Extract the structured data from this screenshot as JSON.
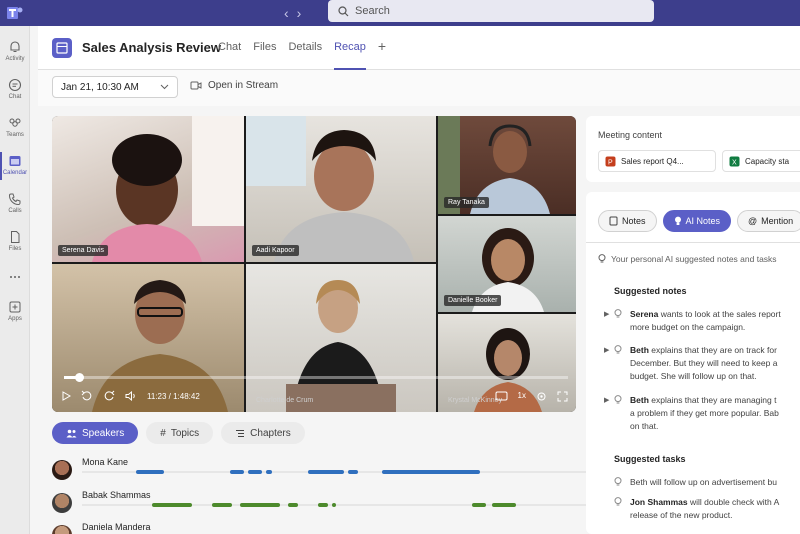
{
  "app": {
    "search_placeholder": "Search"
  },
  "rail": [
    {
      "label": "Activity",
      "icon": "bell-icon"
    },
    {
      "label": "Chat",
      "icon": "chat-icon"
    },
    {
      "label": "Teams",
      "icon": "teams-icon"
    },
    {
      "label": "Calendar",
      "icon": "calendar-icon",
      "active": true
    },
    {
      "label": "Calls",
      "icon": "phone-icon"
    },
    {
      "label": "Files",
      "icon": "file-icon"
    },
    {
      "label": "",
      "icon": "more-icon"
    },
    {
      "label": "Apps",
      "icon": "apps-icon"
    }
  ],
  "header": {
    "title": "Sales Analysis Review",
    "tabs": [
      "Chat",
      "Files",
      "Details",
      "Recap"
    ],
    "active_tab": "Recap"
  },
  "subheader": {
    "date": "Jan 21, 10:30 AM",
    "open_stream": "Open in Stream"
  },
  "video": {
    "participants": [
      "Serena Davis",
      "Aadi Kapoor",
      "Ray Tanaka",
      "Danielle Booker",
      "Charlotte de Crum",
      "Krystal McKinney"
    ],
    "time": "11:23 / 1:48:42",
    "progress": 0.03,
    "speed": "1x"
  },
  "recap_tabs": [
    "Speakers",
    "Topics",
    "Chapters"
  ],
  "speakers": [
    {
      "name": "Mona Kane",
      "color": "#2f6fbe"
    },
    {
      "name": "Babak Shammas",
      "color": "#4d8a2c"
    },
    {
      "name": "Daniela Mandera",
      "color": "#8a5bb0"
    }
  ],
  "right_panel": {
    "meeting_content_title": "Meeting content",
    "files": [
      {
        "name": "Sales report Q4...",
        "icon": "powerpoint-icon",
        "color": "#c43e1c"
      },
      {
        "name": "Capacity sta",
        "icon": "excel-icon",
        "color": "#107c41"
      }
    ],
    "tabs": [
      "Notes",
      "AI Notes",
      "Mention"
    ],
    "active_tab": "AI Notes",
    "ai_hint": "Your personal AI suggested notes and tasks",
    "suggested_notes_title": "Suggested notes",
    "notes": [
      {
        "who": "Serena",
        "lines": [
          " wants to look at the sales report",
          "more budget on the campaign."
        ]
      },
      {
        "who": "Beth",
        "lines": [
          " explains that they are on track for",
          "December. But they will need to keep a",
          "budget. She will follow up on that."
        ]
      },
      {
        "who": "Beth",
        "lines": [
          " explains that they are managing t",
          "a problem if they get more popular. Bab",
          "on that."
        ]
      }
    ],
    "suggested_tasks_title": "Suggested tasks",
    "tasks": [
      {
        "who": "",
        "lines": [
          "Beth will follow up on advertisement bu"
        ]
      },
      {
        "who": "Jon Shammas",
        "lines": [
          " will double check with A",
          "release of the new product."
        ]
      }
    ]
  }
}
